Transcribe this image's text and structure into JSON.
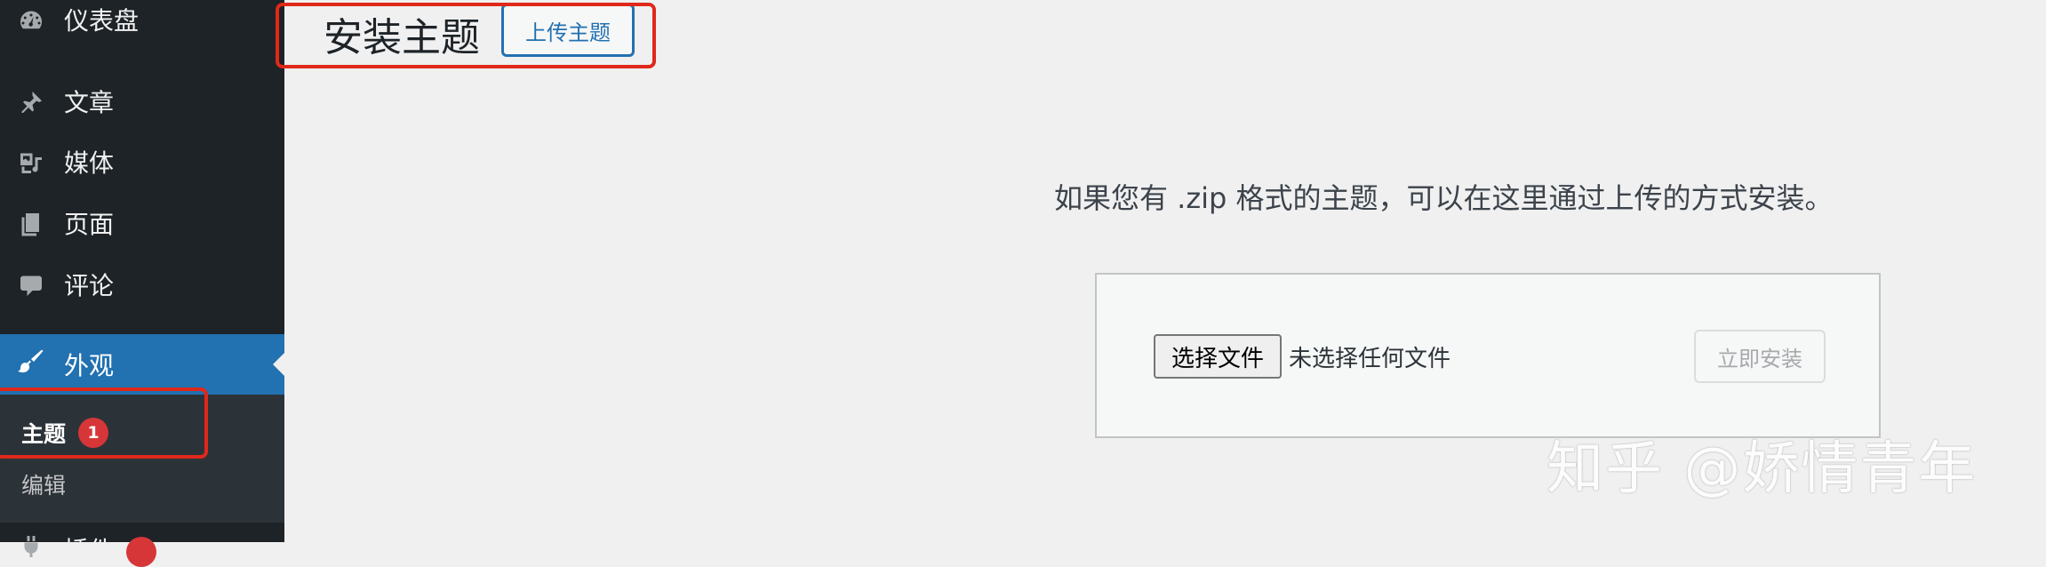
{
  "sidebar": {
    "items": [
      {
        "id": "dashboard",
        "label": "仪表盘",
        "icon": "dashboard-icon"
      },
      {
        "id": "posts",
        "label": "文章",
        "icon": "pin-icon"
      },
      {
        "id": "media",
        "label": "媒体",
        "icon": "media-icon"
      },
      {
        "id": "pages",
        "label": "页面",
        "icon": "pages-icon"
      },
      {
        "id": "comments",
        "label": "评论",
        "icon": "comment-icon"
      },
      {
        "id": "appearance",
        "label": "外观",
        "icon": "paintbrush-icon",
        "active": true
      },
      {
        "id": "plugins",
        "label": "插件",
        "icon": "plugin-icon"
      }
    ],
    "submenu": {
      "themes_label": "主题",
      "themes_badge": "1",
      "editor_label": "编辑"
    }
  },
  "header": {
    "title": "安装主题",
    "upload_button": "上传主题"
  },
  "main": {
    "description": "如果您有 .zip 格式的主题，可以在这里通过上传的方式安装。",
    "choose_file_button": "选择文件",
    "no_file_text": "未选择任何文件",
    "install_button": "立即安装"
  },
  "watermark": "知乎 @娇情青年",
  "colors": {
    "sidebar_bg": "#1d2327",
    "accent": "#2271b1",
    "badge": "#d63638",
    "highlight": "#e0281b",
    "page_bg": "#f0f0f1"
  }
}
